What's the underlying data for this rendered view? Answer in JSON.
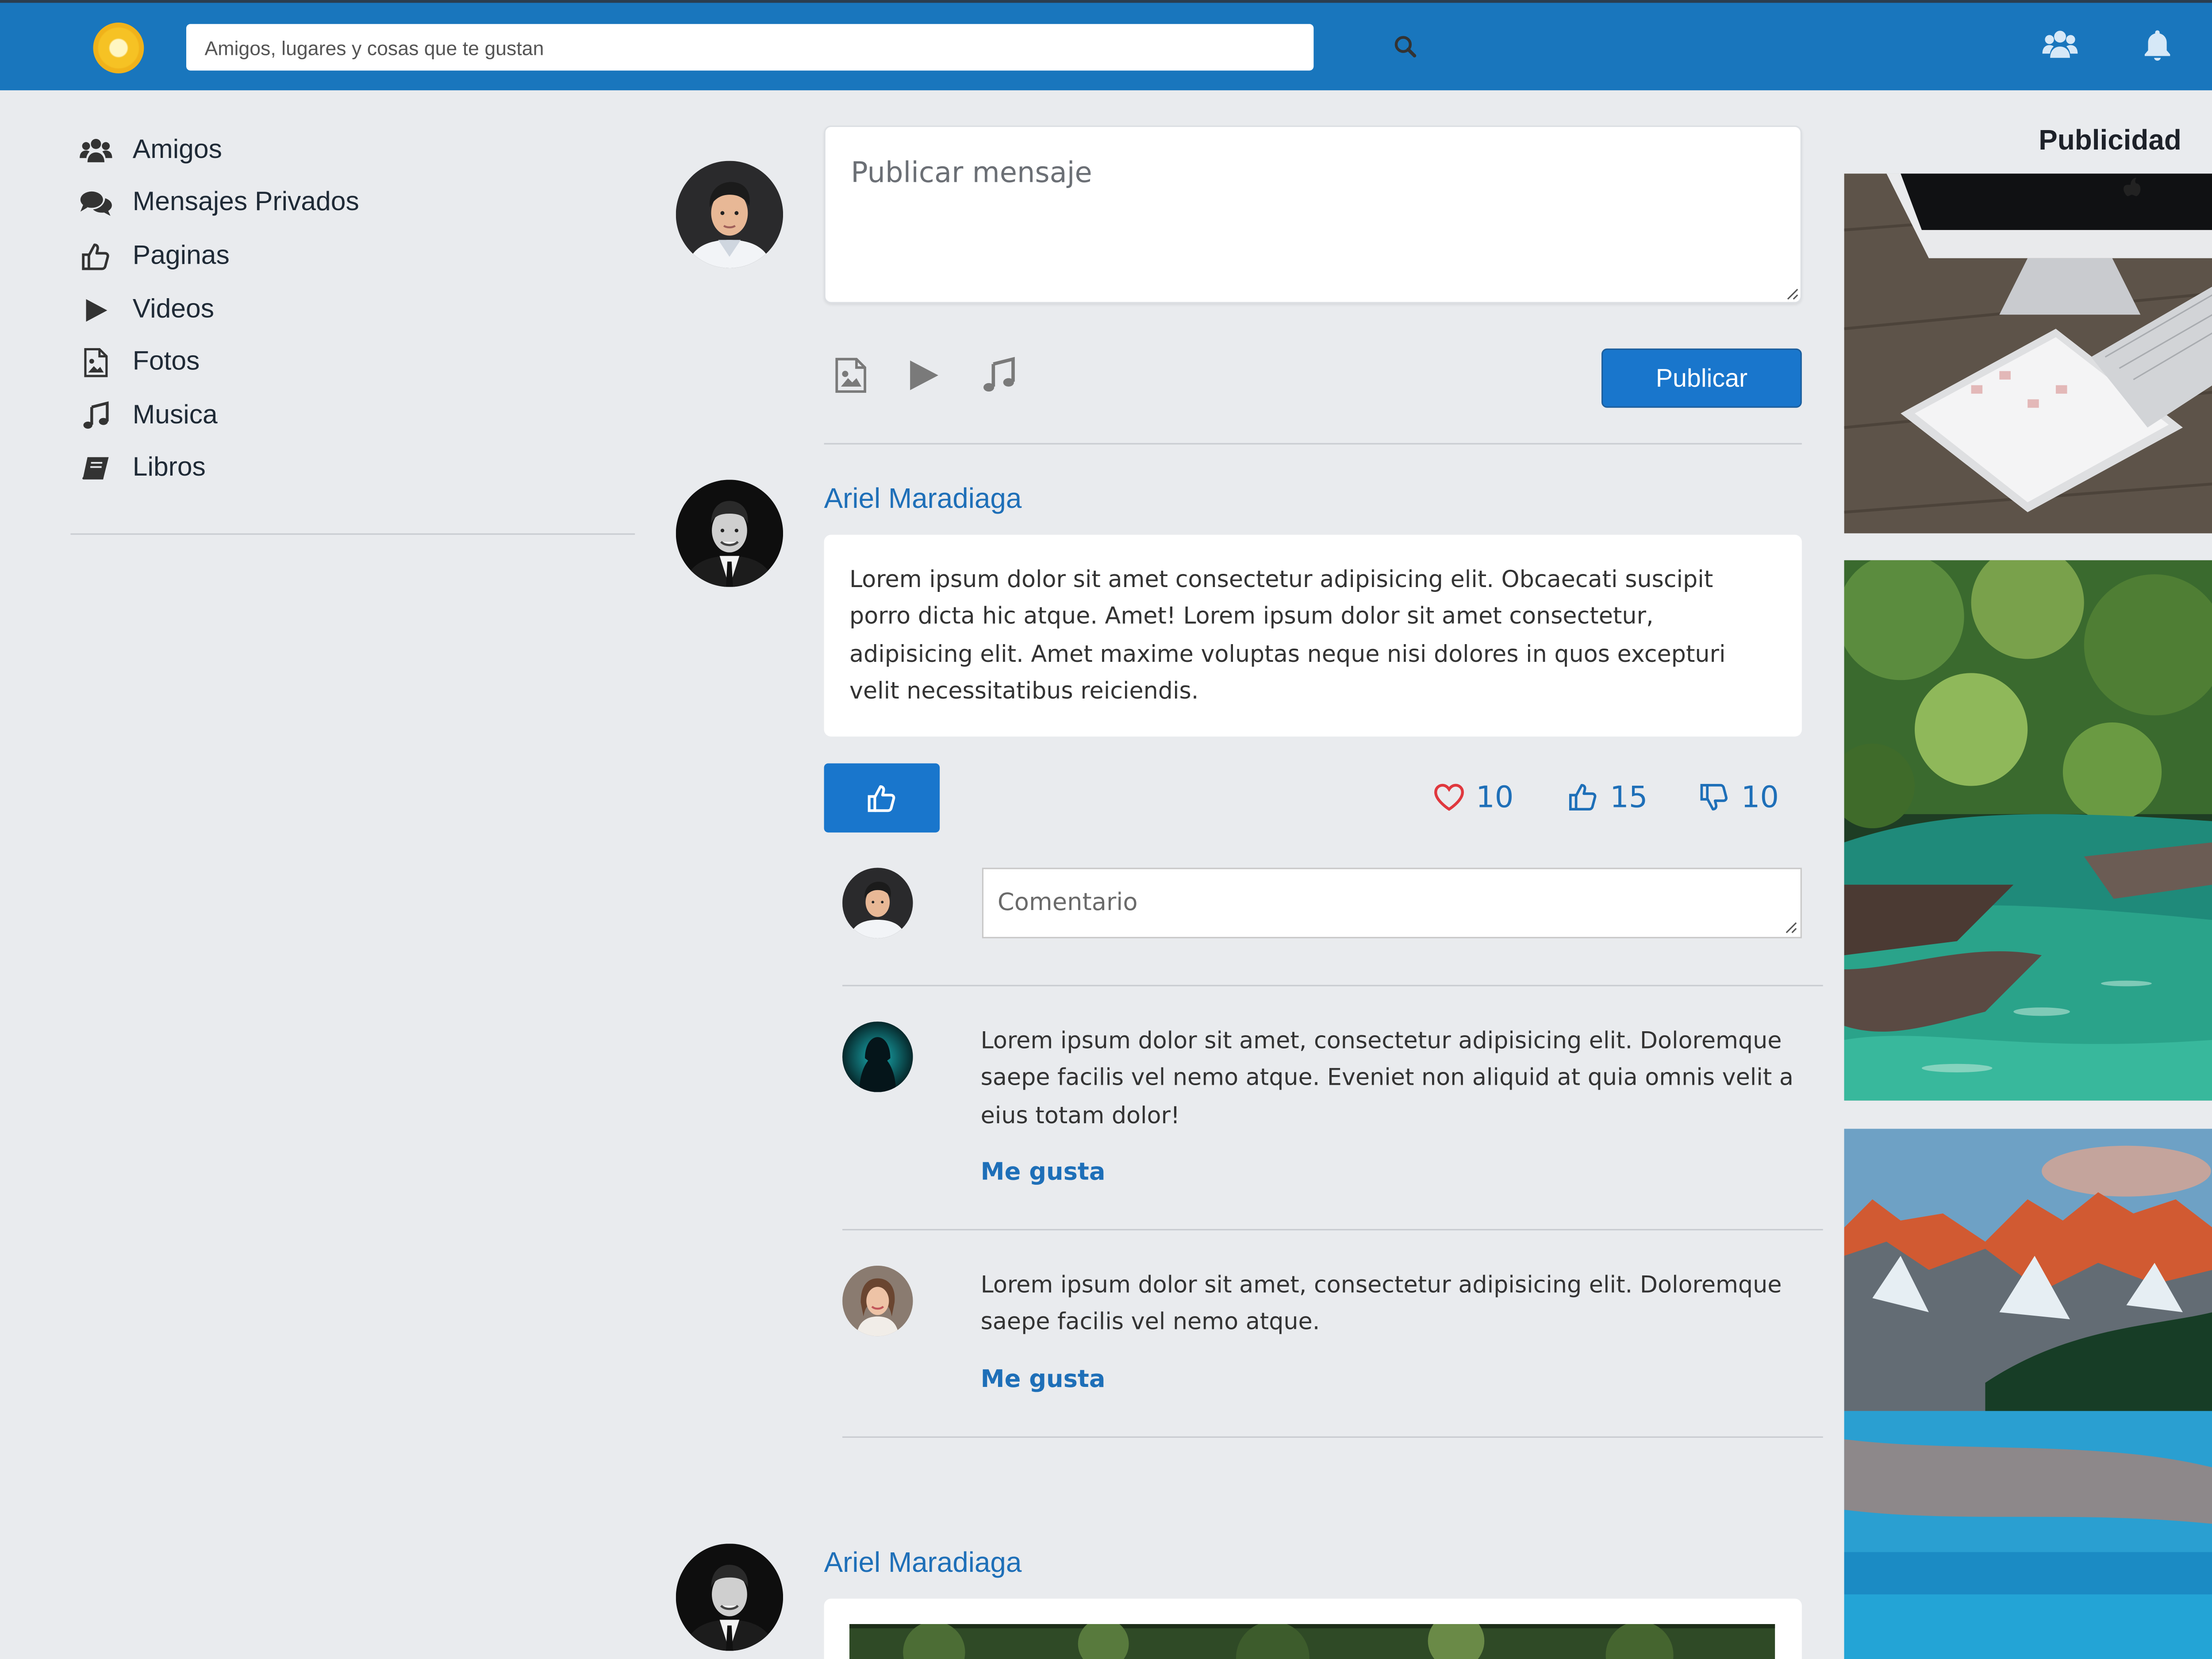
{
  "header": {
    "search_placeholder": "Amigos, lugares y cosas que te gustan"
  },
  "sidebar": {
    "items": [
      {
        "label": "Amigos",
        "icon": "users-icon"
      },
      {
        "label": "Mensajes Privados",
        "icon": "comments-icon"
      },
      {
        "label": "Paginas",
        "icon": "thumbs-up-icon"
      },
      {
        "label": "Videos",
        "icon": "play-icon"
      },
      {
        "label": "Fotos",
        "icon": "image-file-icon"
      },
      {
        "label": "Musica",
        "icon": "music-icon"
      },
      {
        "label": "Libros",
        "icon": "book-icon"
      }
    ]
  },
  "composer": {
    "placeholder": "Publicar mensaje",
    "publish_label": "Publicar"
  },
  "posts": [
    {
      "author": "Ariel Maradiaga",
      "text": "Lorem ipsum dolor sit amet consectetur adipisicing elit. Obcaecati suscipit porro dicta hic atque. Amet! Lorem ipsum dolor sit amet consectetur, adipisicing elit. Amet maxime voluptas neque nisi dolores in quos excepturi velit necessitatibus reiciendis.",
      "stats": {
        "hearts": "10",
        "likes": "15",
        "dislikes": "10"
      },
      "comment_placeholder": "Comentario",
      "comments": [
        {
          "text": "Lorem ipsum dolor sit amet, consectetur adipisicing elit. Doloremque saepe facilis vel nemo atque. Eveniet non aliquid at quia omnis velit a eius totam dolor!",
          "like_label": "Me gusta"
        },
        {
          "text": "Lorem ipsum dolor sit amet, consectetur adipisicing elit. Doloremque saepe facilis vel nemo atque.",
          "like_label": "Me gusta"
        }
      ]
    },
    {
      "author": "Ariel Maradiaga"
    }
  ],
  "ads": {
    "title": "Publicidad"
  },
  "colors": {
    "topbar": "#1976bd",
    "accent": "#1976cc",
    "link": "#1e6fb8",
    "heart": "#e0383e",
    "background": "#e9ebee"
  }
}
